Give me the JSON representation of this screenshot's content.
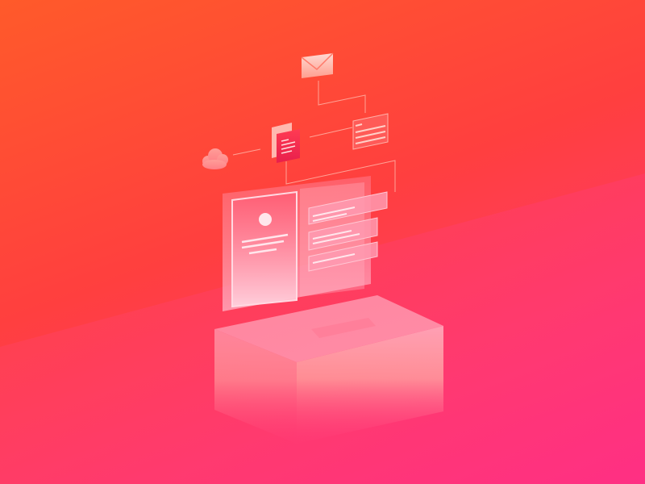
{
  "scene": {
    "description_visible_text": "",
    "icons": [
      "envelope-icon",
      "document-icon",
      "list-window-icon",
      "cloud-icon",
      "laptop-screen-icon",
      "profile-card-icon",
      "chat-bubble-icon",
      "base-box-icon"
    ]
  },
  "colors": {
    "background_top": "#ff5a2a",
    "background_mid": "#ff3f3f",
    "background_bottom": "#ff2f80",
    "accent": "#ff7aa6",
    "highlight": "#ffd6e3"
  }
}
